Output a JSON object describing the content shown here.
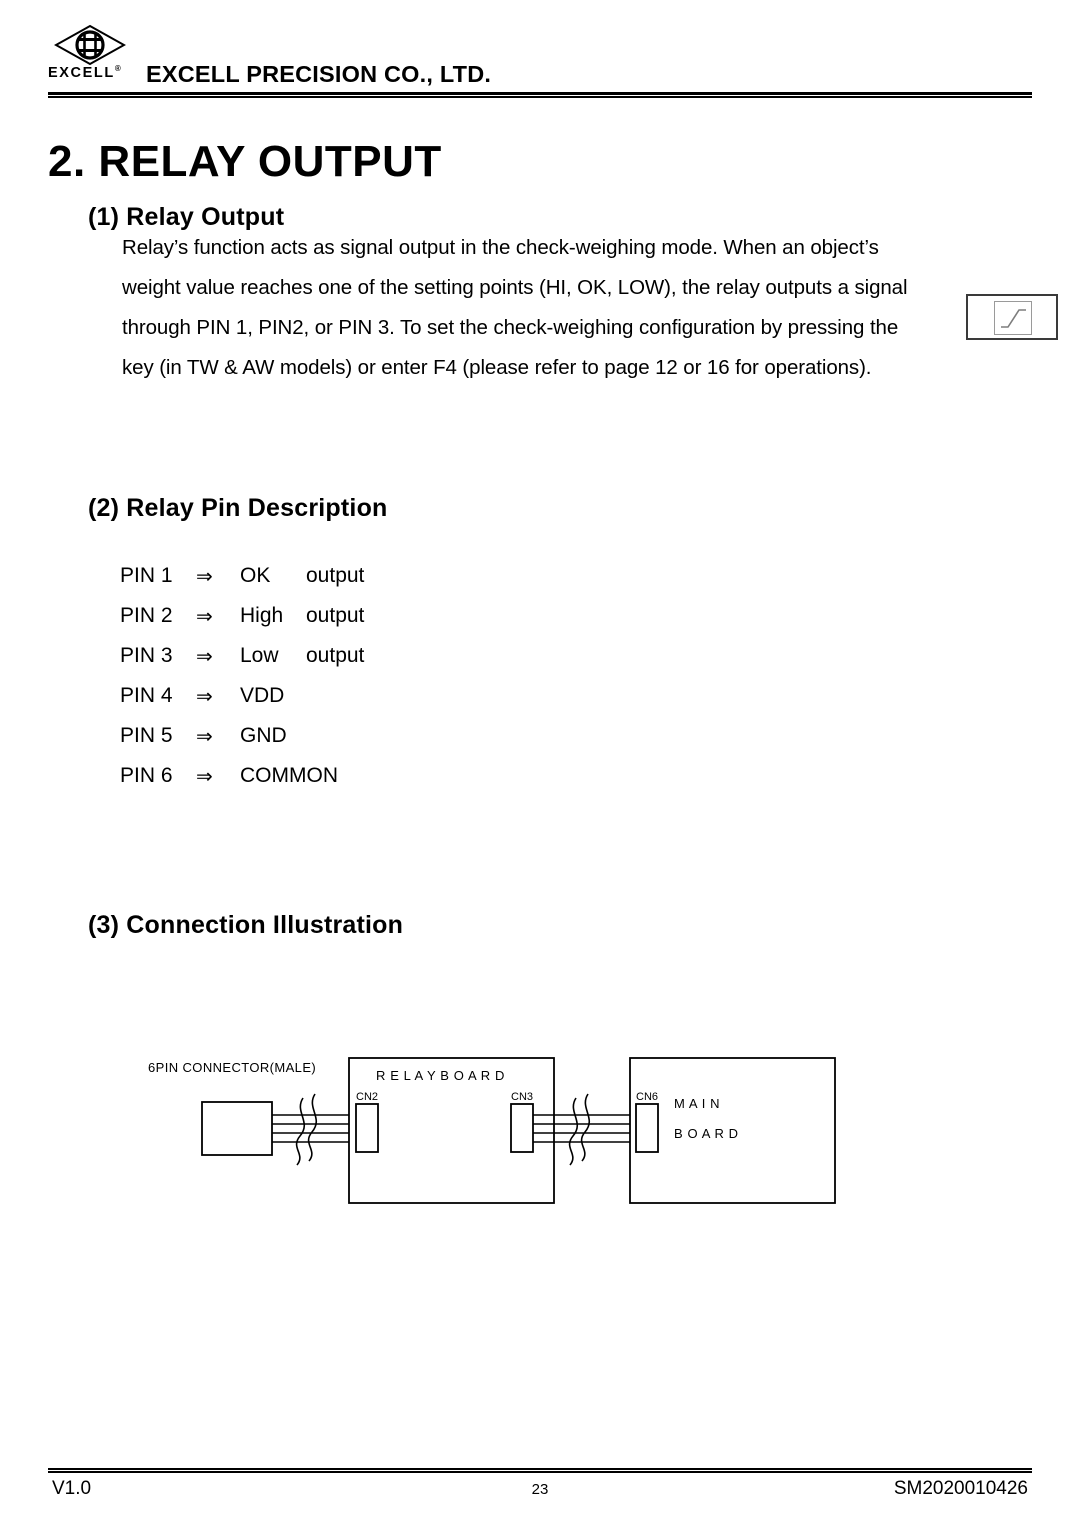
{
  "header": {
    "logo_word": "EXCELL",
    "logo_registered": "®",
    "company_name": "EXCELL PRECISION CO., LTD.",
    "logo_icon": "excell-diamond-wheel-logo"
  },
  "title": "2. RELAY OUTPUT",
  "sections": [
    {
      "heading": "(1) Relay Output",
      "paragraph_lines": [
        "Relay’s function acts as signal output in the check-weighing mode. When an object’s",
        "weight value reaches one of the setting points (HI, OK, LOW), the relay outputs a signal",
        "through PIN 1, PIN2, or PIN 3. To set the check-weighing configuration by pressing the",
        "key (in TW & AW models) or enter F4 (please refer to page 12 or 16 for operations)."
      ],
      "key_graphic_icon": "ramp-step-key-icon"
    },
    {
      "heading": "(2) Relay Pin Description",
      "pins": [
        {
          "pin": "PIN 1",
          "arrow": "⇒",
          "signal": "OK",
          "kind": "output"
        },
        {
          "pin": "PIN 2",
          "arrow": "⇒",
          "signal": "High",
          "kind": "output"
        },
        {
          "pin": "PIN 3",
          "arrow": "⇒",
          "signal": "Low",
          "kind": "output"
        },
        {
          "pin": "PIN 4",
          "arrow": "⇒",
          "signal": "VDD",
          "kind": ""
        },
        {
          "pin": "PIN 5",
          "arrow": "⇒",
          "signal": "GND",
          "kind": ""
        },
        {
          "pin": "PIN 6",
          "arrow": "⇒",
          "signal": "COMMON",
          "kind": ""
        }
      ]
    },
    {
      "heading": "(3) Connection Illustration",
      "diagram": {
        "connector_label": "6PIN CONNECTOR(MALE)",
        "relay_board_label": "R E L A Y   B O A R D",
        "relay_board_cn_left": "CN2",
        "relay_board_cn_right": "CN3",
        "main_board_cn": "CN6",
        "main_board_label_line1": "M A I N",
        "main_board_label_line2": "B O A R D"
      }
    }
  ],
  "footer": {
    "version": "V1.0",
    "page_number": "23",
    "document_number": "SM2020010426"
  }
}
